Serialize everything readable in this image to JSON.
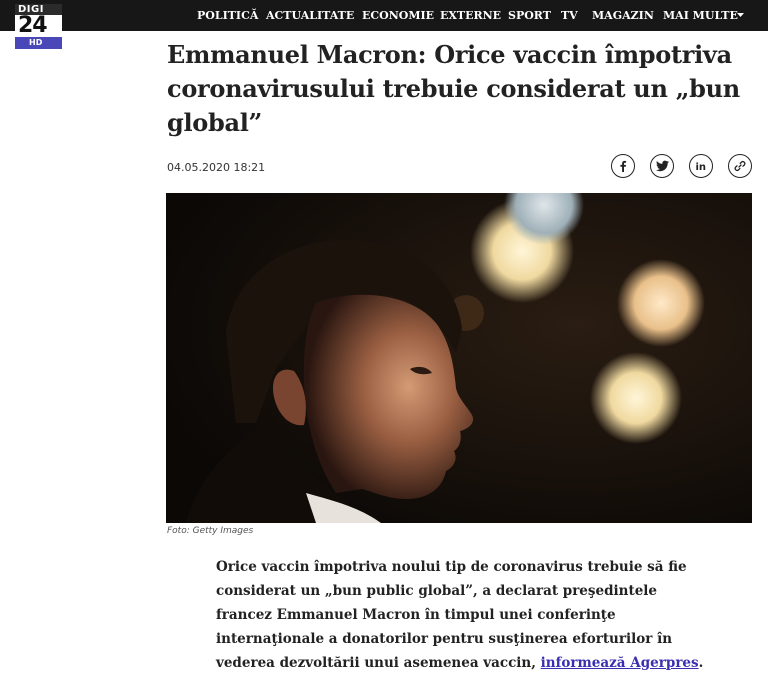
{
  "logo": {
    "top": "DIGI",
    "number": "24",
    "badge": "HD"
  },
  "nav": {
    "items": [
      "POLITICĂ",
      "ACTUALITATE",
      "ECONOMIE",
      "EXTERNE",
      "SPORT",
      "TV",
      "MAGAZIN",
      "MAI MULTE"
    ],
    "more_icon": "chevron-down-icon"
  },
  "article": {
    "headline": "Emmanuel Macron: Orice vaccin împotriva coronavirusului trebuie considerat un „bun global”",
    "date": "04.05.2020 18:21",
    "share_icons": [
      "facebook-icon",
      "twitter-icon",
      "linkedin-icon",
      "link-icon"
    ],
    "photo_caption": "Foto: Getty Images",
    "body_text": "Orice vaccin împotriva noului tip de coronavirus trebuie să fie considerat un „bun public global”, a declarat preşedintele francez Emmanuel Macron în timpul unei conferinţe internaţionale a donatorilor pentru susţinerea eforturilor în vederea dezvoltării unui asemenea vaccin, ",
    "link_text": "informează Agerpres",
    "body_end": "."
  },
  "colors": {
    "topbar": "#171717",
    "hd_badge": "#4a48b8",
    "link": "#3a2fb0"
  }
}
